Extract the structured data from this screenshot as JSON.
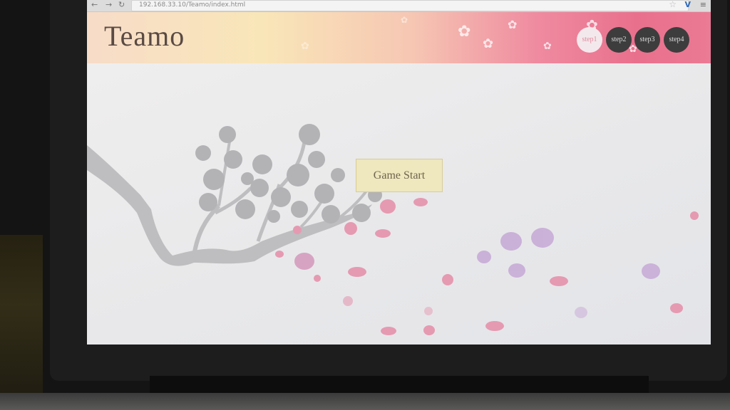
{
  "browser": {
    "back_icon": "arrow-left-icon",
    "reload_icon": "reload-icon",
    "url": "192.168.33.10/Teamo/index.html",
    "star_icon": "star-icon",
    "extension_icon": "extension-icon",
    "menu_icon": "menu-icon"
  },
  "header": {
    "title": "Teamo",
    "steps": [
      {
        "label": "step1",
        "active": true
      },
      {
        "label": "step2",
        "active": false
      },
      {
        "label": "step3",
        "active": false
      },
      {
        "label": "step4",
        "active": false
      }
    ]
  },
  "main": {
    "start_button": "Game Start",
    "illustration": "cherry-blossom-branch"
  },
  "colors": {
    "header_pink": "#ef8ba0",
    "header_cream": "#f9e6b8",
    "step_inactive": "#3d3d3d",
    "step_active": "#f3e9ec",
    "button_bg": "#efe7bd",
    "branch": "#bdbcbe",
    "petal": "#e28aa6"
  }
}
